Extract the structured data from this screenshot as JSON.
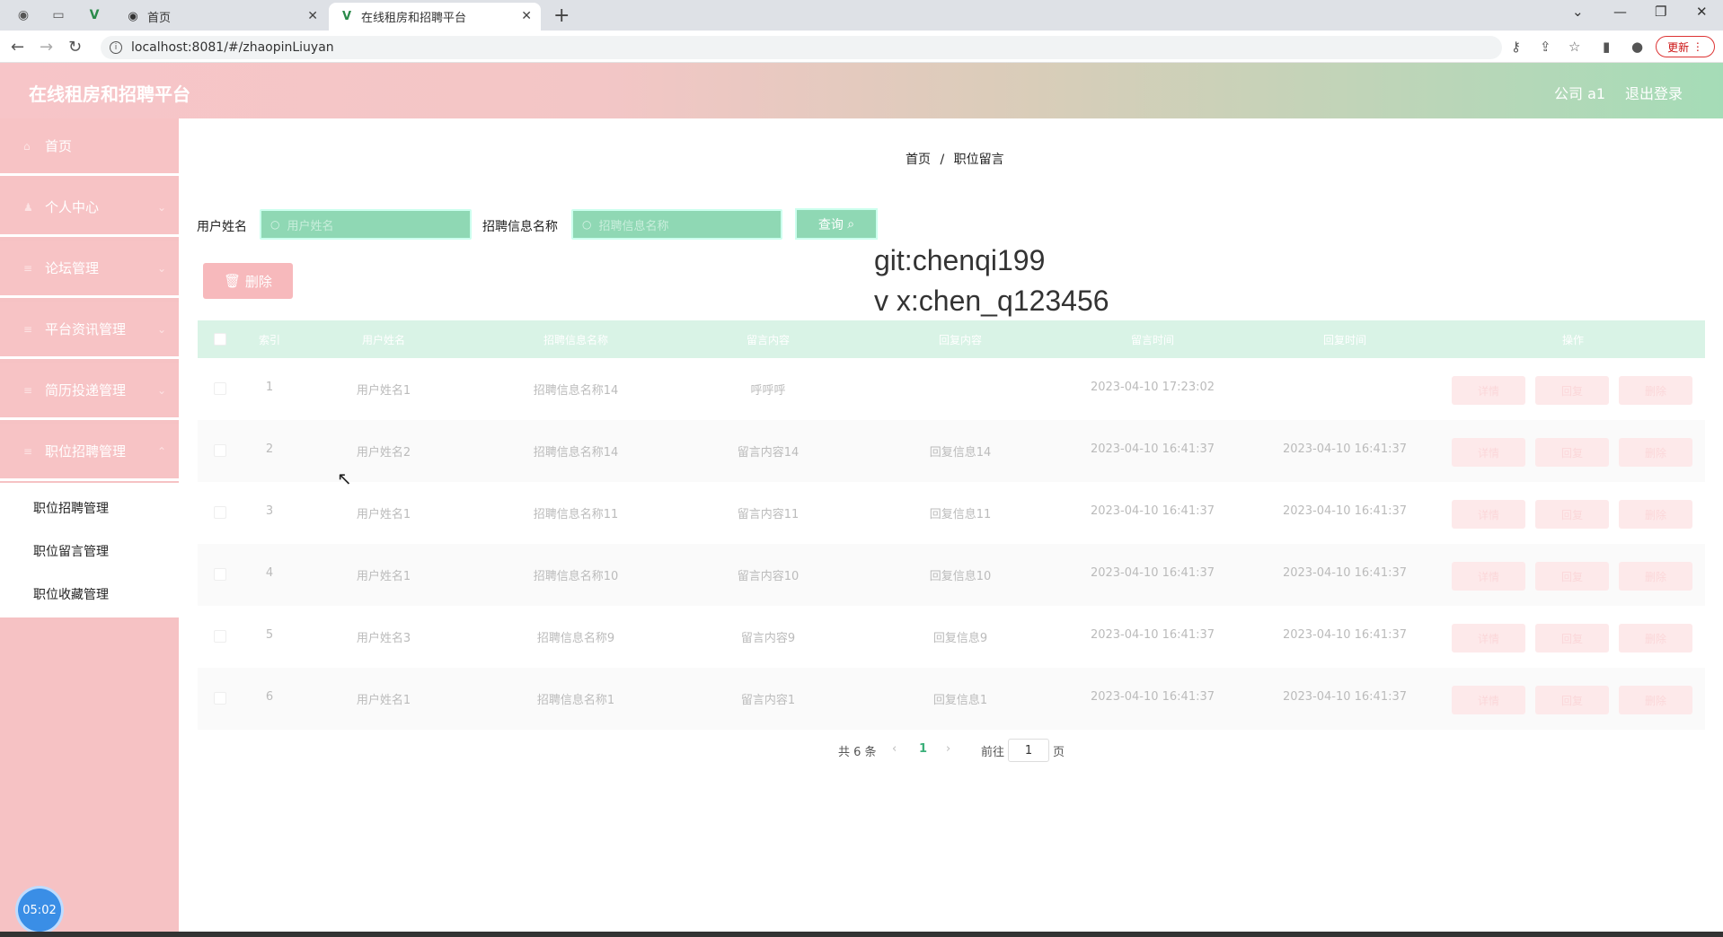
{
  "browser": {
    "tabs": [
      {
        "title": "首页",
        "active": false
      },
      {
        "title": "在线租房和招聘平台",
        "active": true
      }
    ],
    "url": "localhost:8081/#/zhaopinLiuyan",
    "update_label": "更新"
  },
  "header": {
    "title": "在线租房和招聘平台",
    "user": "公司 a1",
    "logout": "退出登录"
  },
  "sidebar": {
    "items": [
      {
        "label": "首页",
        "icon": "home-icon"
      },
      {
        "label": "个人中心",
        "icon": "user-icon"
      },
      {
        "label": "论坛管理",
        "icon": "list-icon"
      },
      {
        "label": "平台资讯管理",
        "icon": "list-icon"
      },
      {
        "label": "简历投递管理",
        "icon": "list-icon"
      },
      {
        "label": "职位招聘管理",
        "icon": "list-icon"
      }
    ],
    "submenu": [
      "职位招聘管理",
      "职位留言管理",
      "职位收藏管理"
    ],
    "clock": "05:02"
  },
  "breadcrumb": {
    "home": "首页",
    "sep": "/",
    "current": "职位留言"
  },
  "search": {
    "username_label": "用户姓名",
    "username_placeholder": "用户姓名",
    "job_label": "招聘信息名称",
    "job_placeholder": "招聘信息名称",
    "query_label": "查询"
  },
  "delete_label": "删除",
  "watermark": {
    "line1": "git:chenqi199",
    "line2": "v x:chen_q123456"
  },
  "table": {
    "headers": [
      "索引",
      "用户姓名",
      "招聘信息名称",
      "留言内容",
      "回复内容",
      "留言时间",
      "回复时间",
      "操作"
    ],
    "rows": [
      {
        "idx": "1",
        "user": "用户姓名1",
        "job": "招聘信息名称14",
        "msg": "呼呼呼",
        "reply": "",
        "time": "2023-04-10 17:23:02",
        "reply_time": ""
      },
      {
        "idx": "2",
        "user": "用户姓名2",
        "job": "招聘信息名称14",
        "msg": "留言内容14",
        "reply": "回复信息14",
        "time": "2023-04-10 16:41:37",
        "reply_time": "2023-04-10 16:41:37"
      },
      {
        "idx": "3",
        "user": "用户姓名1",
        "job": "招聘信息名称11",
        "msg": "留言内容11",
        "reply": "回复信息11",
        "time": "2023-04-10 16:41:37",
        "reply_time": "2023-04-10 16:41:37"
      },
      {
        "idx": "4",
        "user": "用户姓名1",
        "job": "招聘信息名称10",
        "msg": "留言内容10",
        "reply": "回复信息10",
        "time": "2023-04-10 16:41:37",
        "reply_time": "2023-04-10 16:41:37"
      },
      {
        "idx": "5",
        "user": "用户姓名3",
        "job": "招聘信息名称9",
        "msg": "留言内容9",
        "reply": "回复信息9",
        "time": "2023-04-10 16:41:37",
        "reply_time": "2023-04-10 16:41:37"
      },
      {
        "idx": "6",
        "user": "用户姓名1",
        "job": "招聘信息名称1",
        "msg": "留言内容1",
        "reply": "回复信息1",
        "time": "2023-04-10 16:41:37",
        "reply_time": "2023-04-10 16:41:37"
      }
    ],
    "actions": [
      "详情",
      "回复",
      "删除"
    ]
  },
  "pagination": {
    "total": "共 6 条",
    "current": "1",
    "goto": "前往",
    "page_value": "1",
    "page_unit": "页"
  }
}
